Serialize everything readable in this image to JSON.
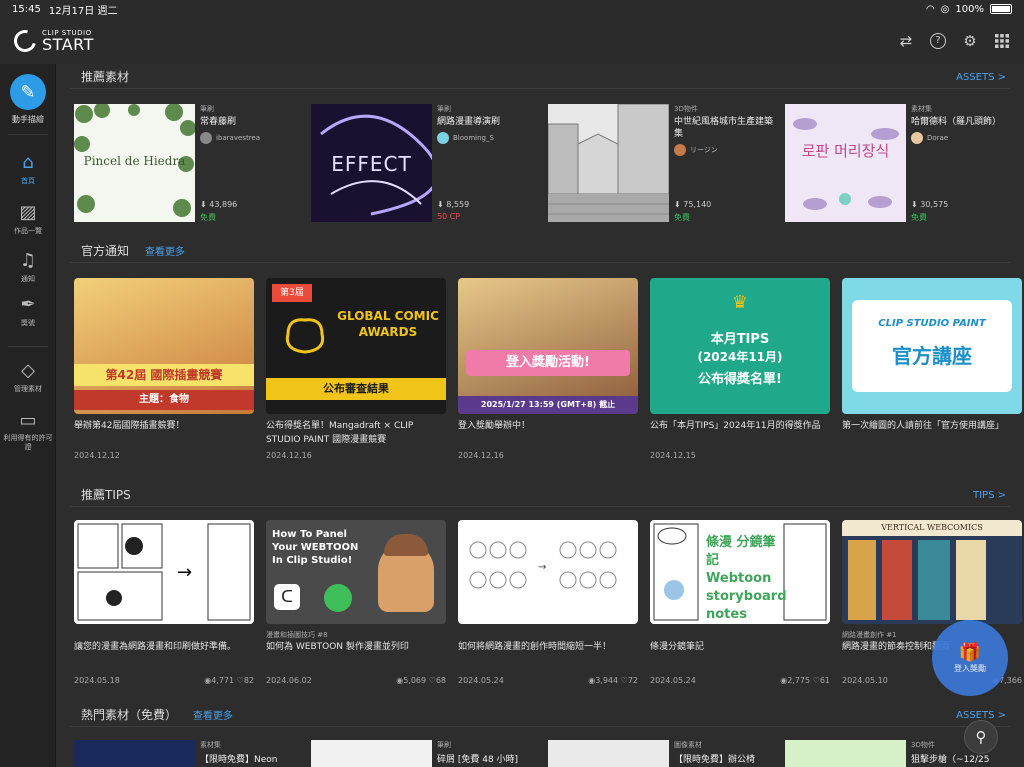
{
  "status": {
    "time": "15:45",
    "date": "12月17日 週二",
    "battery": "100%"
  },
  "app": {
    "logo_small": "CLIP STUDIO",
    "logo_big": "START"
  },
  "sidebar": {
    "cta_label": "動手描繪",
    "items": [
      {
        "label": "首頁",
        "icon": "home-icon"
      },
      {
        "label": "作品一覽",
        "icon": "gallery-icon"
      },
      {
        "label": "通知",
        "icon": "bell-icon"
      },
      {
        "label": "獎號",
        "icon": "pen-icon"
      },
      {
        "label": "管理素材",
        "icon": "shapes-icon"
      },
      {
        "label": "利用得有的許可證",
        "icon": "license-icon"
      }
    ]
  },
  "recommended_assets": {
    "title": "推薦素材",
    "link": "ASSETS >",
    "items": [
      {
        "category": "筆刷",
        "name": "常春藤刷",
        "author": "ibaravestrea",
        "downloads": "43,896",
        "price": "免費",
        "price_type": "free"
      },
      {
        "category": "筆刷",
        "name": "網路漫畫導演刷",
        "author": "Blooming_S",
        "downloads": "8,559",
        "price": "50 CP",
        "price_type": "cp"
      },
      {
        "category": "3D物件",
        "name": "中世紀風格城市生產建築集",
        "author": "リージン",
        "downloads": "75,140",
        "price": "免費",
        "price_type": "free"
      },
      {
        "category": "素材集",
        "name": "哈爾德科（羅凡頭飾）",
        "author": "Dorae",
        "downloads": "30,575",
        "price": "免費",
        "price_type": "free"
      }
    ],
    "thumb_text": [
      "Pincel de Hiedra",
      "EFFECT",
      "",
      "로판 머리장식"
    ]
  },
  "notices": {
    "title": "官方通知",
    "more": "查看更多",
    "items": [
      {
        "title": "舉辦第42屆國際插畫競賽！",
        "date": "2024.12.12",
        "banner_a": "第42屆 國際插畫競賽",
        "banner_b": "主題：食物"
      },
      {
        "title": "公布得獎名單！Mangadraft × CLIP STUDIO PAINT 國際漫畫競賽",
        "date": "2024.12.16",
        "banner_a": "GLOBAL COMIC AWARDS",
        "banner_b": "公布審查結果"
      },
      {
        "title": "登入獎勵舉辦中！",
        "date": "2024.12.16",
        "banner_a": "登入獎勵活動!",
        "banner_b": "2025/1/27 13:59 (GMT+8) 截止"
      },
      {
        "title": "公布「本月TIPS」2024年11月的得獎作品",
        "date": "2024.12.15",
        "banner_a": "本月TIPS",
        "banner_b": "(2024年11月)",
        "banner_c": "公布得獎名單!"
      },
      {
        "title": "第一次繪圖的人請前往「官方使用講座」",
        "date": "",
        "banner_a": "CLIP STUDIO PAINT",
        "banner_b": "官方講座"
      }
    ]
  },
  "tips": {
    "title": "推薦TIPS",
    "link": "TIPS >",
    "items": [
      {
        "sub": "",
        "title": "讓您的漫畫為網路漫畫和印刷做好準備。",
        "date": "2024.05.18",
        "views": "4,771",
        "likes": "82"
      },
      {
        "sub": "漫畫和插圖技巧 #8",
        "title": "如何為 WEBTOON 製作漫畫並列印",
        "date": "2024.06.02",
        "views": "5,069",
        "likes": "68",
        "banner": "How To Panel Your WEBTOON In Clip Studio!"
      },
      {
        "sub": "",
        "title": "如何將網路漫畫的創作時間縮短一半！",
        "date": "2024.05.24",
        "views": "3,944",
        "likes": "72"
      },
      {
        "sub": "",
        "title": "條漫分鏡筆記",
        "date": "2024.05.24",
        "views": "2,775",
        "likes": "61",
        "banner": "條漫 分鏡筆記 Webtoon storyboard notes"
      },
      {
        "sub": "網路漫畫創作 #1",
        "title": "網路漫畫的節奏控制和翻頁",
        "date": "2024.05.10",
        "views": "7,366",
        "likes": "",
        "banner": "VERTICAL WEBCOMICS"
      }
    ]
  },
  "hot_assets": {
    "title": "熱門素材（免費）",
    "more": "查看更多",
    "link": "ASSETS >",
    "items": [
      {
        "category": "素材集",
        "name": "【限時免費】Neon"
      },
      {
        "category": "筆刷",
        "name": "碎屑 [免費 48 小時]"
      },
      {
        "category": "圖像素材",
        "name": "【限時免費】辦公椅"
      },
      {
        "category": "3D物件",
        "name": "狙擊步槍（~12/25"
      }
    ]
  },
  "login_bonus": "登入獎勵",
  "colors": {
    "accent": "#4aa3ee",
    "free": "#3fbf5a",
    "cp": "#e94a4a"
  }
}
